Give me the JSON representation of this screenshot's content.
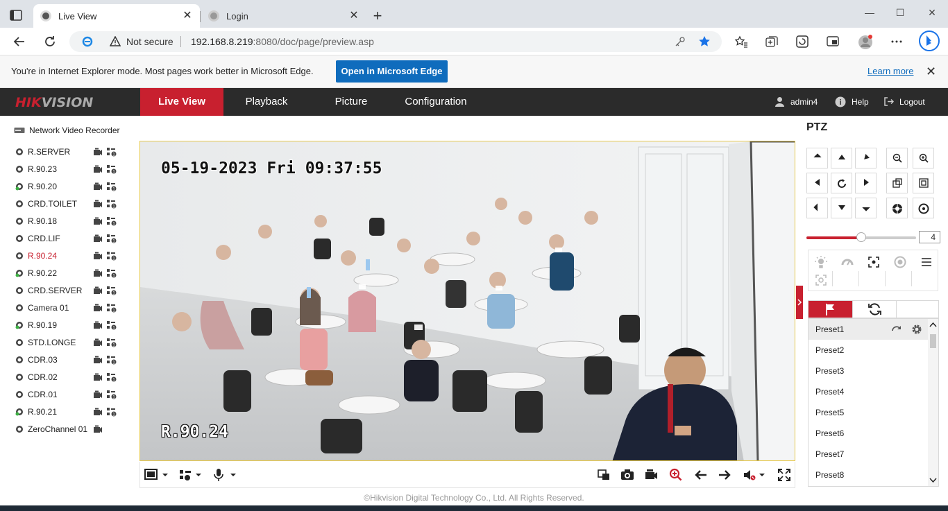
{
  "browser": {
    "tabs": [
      {
        "title": "Live View",
        "active": true
      },
      {
        "title": "Login",
        "active": false
      }
    ],
    "address": {
      "security": "Not secure",
      "host": "192.168.8.219",
      "rest": ":8080/doc/page/preview.asp"
    },
    "ie_banner": {
      "message": "You're in Internet Explorer mode. Most pages work better in Microsoft Edge.",
      "open_button": "Open in Microsoft Edge",
      "learn_more": "Learn more"
    }
  },
  "app": {
    "logo_red": "HIK",
    "logo_gray": "VISION",
    "nav": [
      "Live View",
      "Playback",
      "Picture",
      "Configuration"
    ],
    "user": "admin4",
    "help": "Help",
    "logout": "Logout"
  },
  "tree": {
    "root": "Network Video Recorder",
    "cameras": [
      {
        "name": "R.SERVER",
        "status": "normal"
      },
      {
        "name": "R.90.23",
        "status": "normal"
      },
      {
        "name": "R.90.20",
        "status": "online-green"
      },
      {
        "name": "CRD.TOILET",
        "status": "normal"
      },
      {
        "name": "R.90.18",
        "status": "normal"
      },
      {
        "name": "CRD.LIF",
        "status": "normal"
      },
      {
        "name": "R.90.24",
        "status": "selected"
      },
      {
        "name": "R.90.22",
        "status": "online-green"
      },
      {
        "name": "CRD.SERVER",
        "status": "normal"
      },
      {
        "name": "Camera 01",
        "status": "normal"
      },
      {
        "name": "R.90.19",
        "status": "online-green"
      },
      {
        "name": "STD.LONGE",
        "status": "normal"
      },
      {
        "name": "CDR.03",
        "status": "normal"
      },
      {
        "name": "CDR.02",
        "status": "normal"
      },
      {
        "name": "CDR.01",
        "status": "normal"
      },
      {
        "name": "R.90.21",
        "status": "online-green"
      },
      {
        "name": "ZeroChannel 01",
        "status": "zero"
      }
    ]
  },
  "video": {
    "osd_datetime": "05-19-2023 Fri 09:37:55",
    "osd_channel": "R.90.24"
  },
  "ptz": {
    "title": "PTZ",
    "speed": "4",
    "speed_level_fraction": 0.5,
    "presets": [
      "Preset1",
      "Preset2",
      "Preset3",
      "Preset4",
      "Preset5",
      "Preset6",
      "Preset7",
      "Preset8"
    ]
  },
  "footer": {
    "copyright": "©Hikvision Digital Technology Co., Ltd. All Rights Reserved."
  },
  "colors": {
    "brand_red": "#c8202f",
    "header_dark": "#2b2b2b",
    "edge_blue": "#0f6cbd",
    "video_border": "#e6c84a"
  }
}
